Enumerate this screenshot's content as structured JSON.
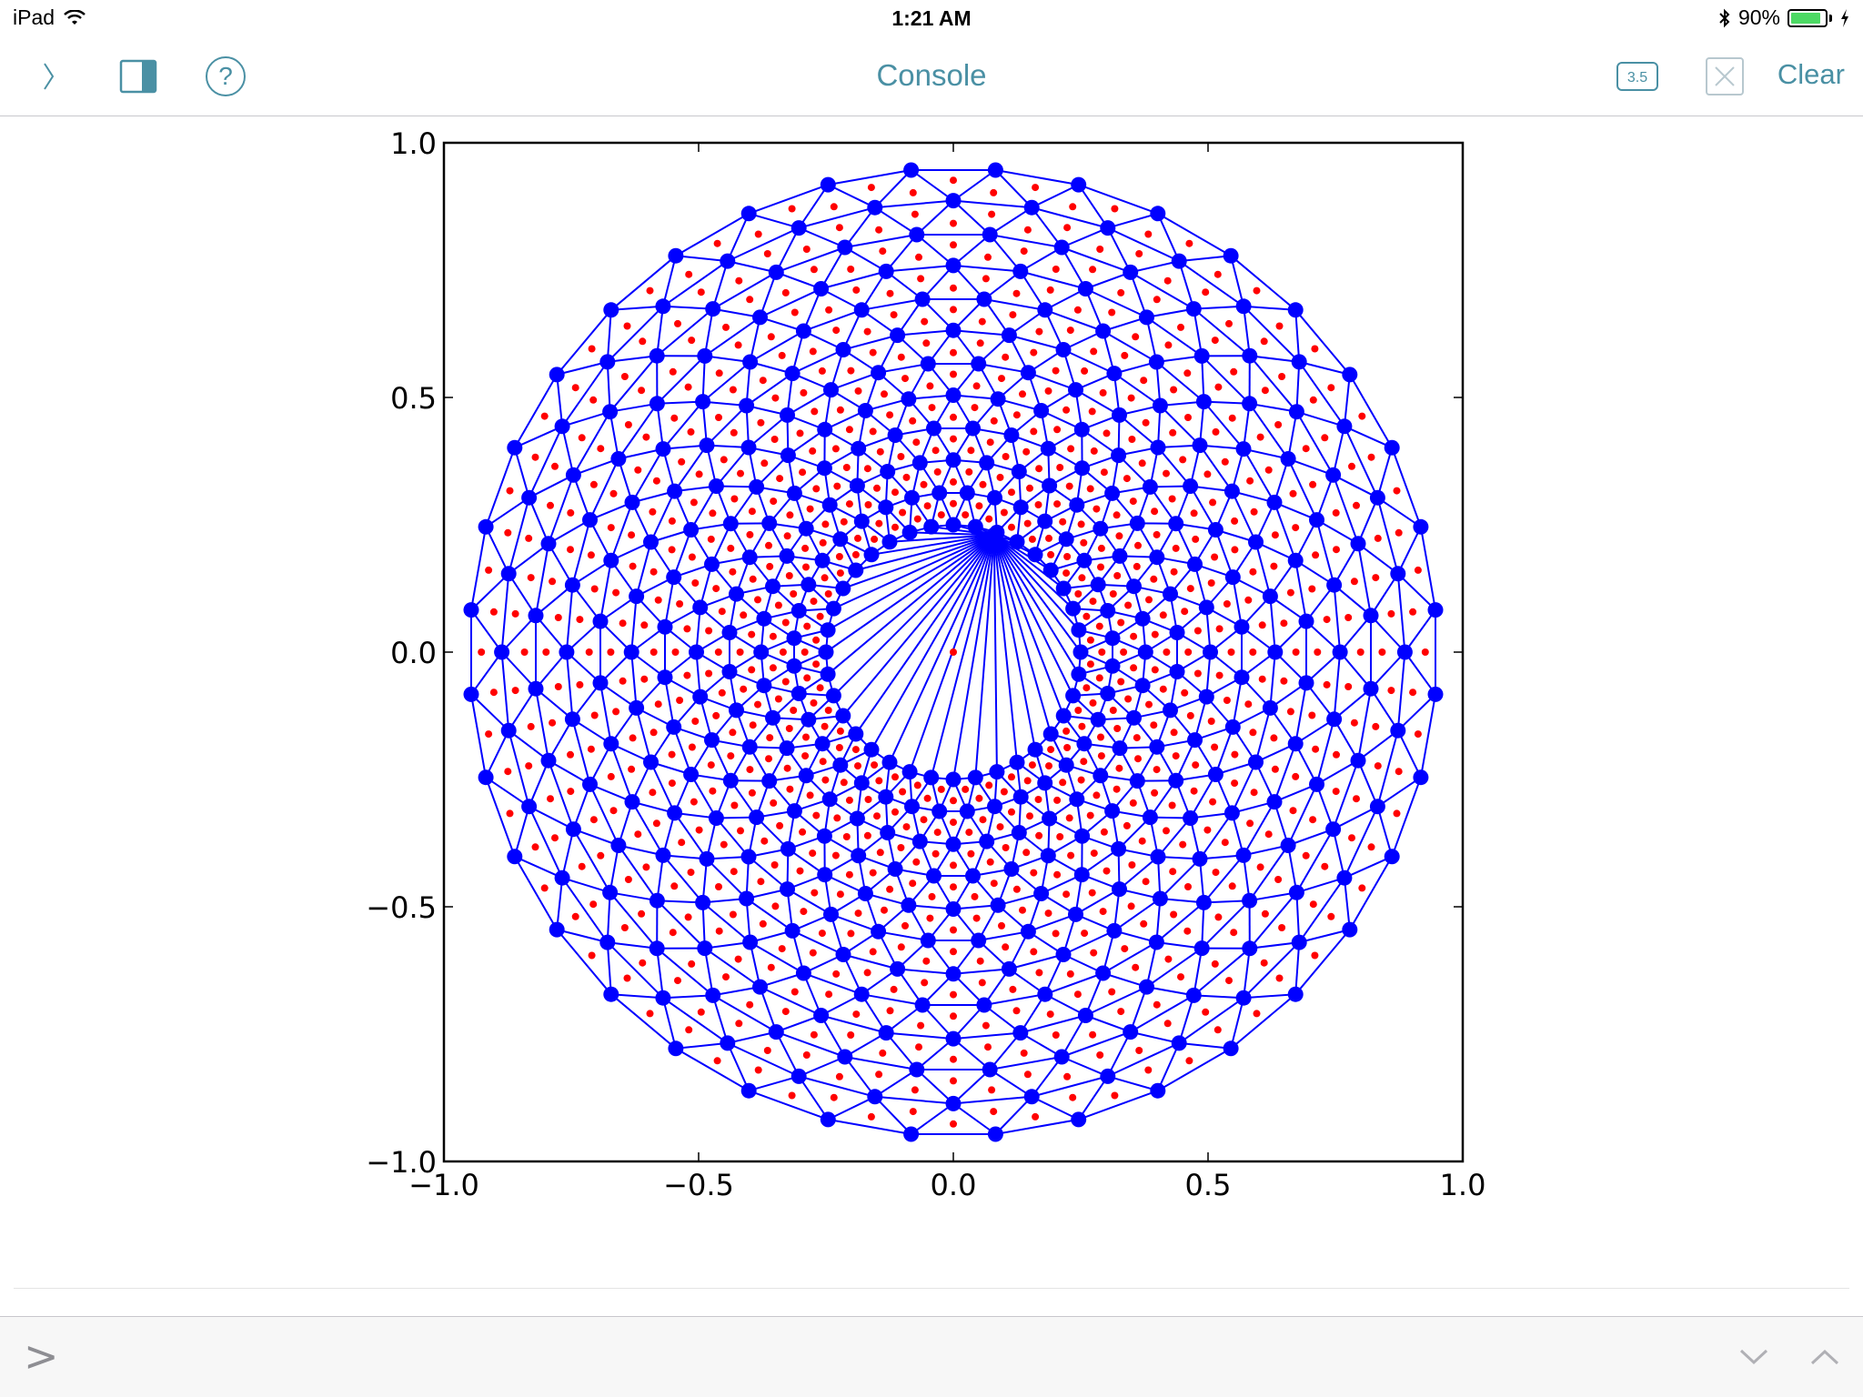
{
  "status": {
    "device": "iPad",
    "time": "1:21 AM",
    "battery_text": "90%",
    "battery_level": 0.9
  },
  "toolbar": {
    "title": "Console",
    "version_badge": "3.5",
    "clear_label": "Clear",
    "accent_color": "#4a90a4"
  },
  "icons": {
    "expand": "chevron-right-icon",
    "panel": "split-panel-icon",
    "help": "question-circle-icon",
    "close": "close-x-icon",
    "history_down": "chevron-down-icon",
    "history_up": "chevron-up-icon"
  },
  "input": {
    "prompt_symbol": ">"
  },
  "chart_data": {
    "type": "scatter",
    "description_kind": "triangulated annulus mesh",
    "xlim": [
      -1.0,
      1.0
    ],
    "ylim": [
      -1.0,
      1.0
    ],
    "x_ticks": [
      "−1.0",
      "−0.5",
      "0.0",
      "0.5",
      "1.0"
    ],
    "y_ticks": [
      "1.0",
      "0.5",
      "0.0",
      "−0.5",
      "−1.0"
    ],
    "x_tick_values": [
      -1.0,
      -0.5,
      0.0,
      0.5,
      1.0
    ],
    "y_tick_values": [
      1.0,
      0.5,
      0.0,
      -0.5,
      -1.0
    ],
    "grid": false,
    "mesh": {
      "outer_radius": 0.95,
      "inner_radius": 0.25,
      "rings": 12,
      "points_per_ring": 36,
      "fan_apex": [
        0.08,
        0.23
      ]
    },
    "colors": {
      "node": "#0000ff",
      "edge": "#0000ff",
      "centroid": "#ff0000"
    }
  }
}
